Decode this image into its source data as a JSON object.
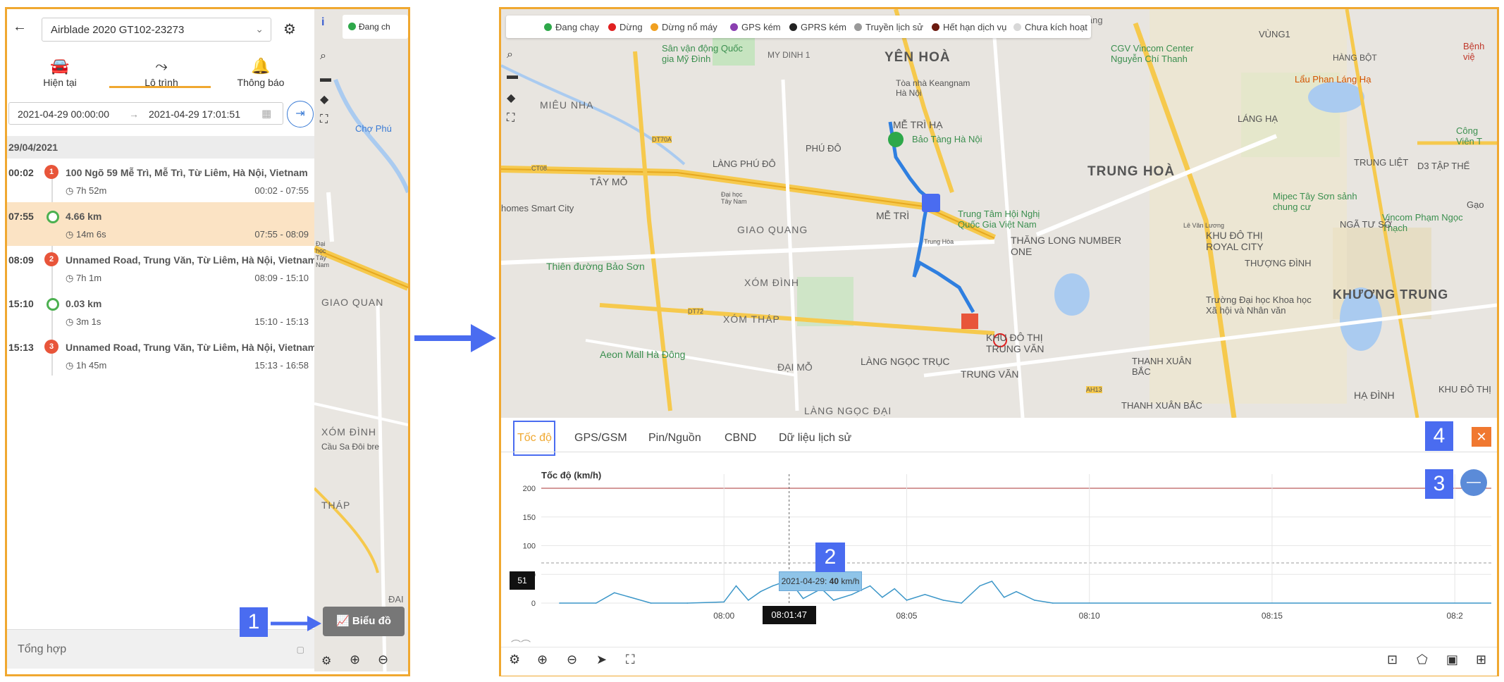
{
  "sidebar": {
    "vehicle_select": "Airblade 2020 GT102-23273",
    "tabs": [
      {
        "label": "Hiện tại",
        "icon": "car-icon"
      },
      {
        "label": "Lộ trình",
        "icon": "route-icon"
      },
      {
        "label": "Thông báo",
        "icon": "bell-icon"
      }
    ],
    "date_from": "2021-04-29 00:00:00",
    "date_to": "2021-04-29 17:01:51",
    "day_header": "29/04/2021",
    "trips": [
      {
        "time": "00:02",
        "marker": "1",
        "type": "stop",
        "address": "100 Ngõ 59 Mễ Trì, Mễ Trì, Từ Liêm, Hà Nội, Vietnam",
        "duration": "7h 52m",
        "range": "00:02 - 07:55"
      },
      {
        "time": "07:55",
        "marker": "",
        "type": "move",
        "address": "4.66 km",
        "duration": "14m 6s",
        "range": "07:55 - 08:09"
      },
      {
        "time": "08:09",
        "marker": "2",
        "type": "stop",
        "address": "Unnamed Road, Trung Văn, Từ Liêm, Hà Nội, Vietnam",
        "duration": "7h 1m",
        "range": "08:09 - 15:10"
      },
      {
        "time": "15:10",
        "marker": "",
        "type": "move",
        "address": "0.03 km",
        "duration": "3m 1s",
        "range": "15:10 - 15:13"
      },
      {
        "time": "15:13",
        "marker": "3",
        "type": "stop",
        "address": "Unnamed Road, Trung Văn, Từ Liêm, Hà Nội, Vietnam",
        "duration": "1h 45m",
        "range": "15:13 - 16:58"
      }
    ],
    "summary": "Tổng hợp"
  },
  "mini_map": {
    "legend_partial": "Đang ch",
    "labels": [
      "Chợ Phú",
      "Đại học Tây Nam",
      "GIAO QUAN",
      "XÓM ĐÌNH",
      "Cầu Sa Đôi bre",
      "THÁP",
      "ĐAI"
    ]
  },
  "chart_button": "Biểu đồ",
  "callouts": [
    "1",
    "2",
    "3",
    "4"
  ],
  "map": {
    "legend": [
      {
        "label": "Đang chạy",
        "color": "#2ea84a"
      },
      {
        "label": "Dừng",
        "color": "#e02020"
      },
      {
        "label": "Dừng nổ máy",
        "color": "#f0a020"
      },
      {
        "label": "GPS kém",
        "color": "#8a3fb0"
      },
      {
        "label": "GPRS kém",
        "color": "#222222"
      },
      {
        "label": "Truyền lịch sử",
        "color": "#999999"
      },
      {
        "label": "Hết hạn dịch vụ",
        "color": "#6b1a10"
      },
      {
        "label": "Chưa kích hoạt",
        "color": "#d8d8d8"
      }
    ],
    "places": [
      "Sân vận động Quốc gia Mỹ Đình",
      "MY DINH 1",
      "YÊN HOÀ",
      "Chùa Láng",
      "CGV Vincom Center Nguyễn Chí Thanh",
      "VÙNG1",
      "Bệnh việ",
      "HÀNG BỘT",
      "Lẩu Phan Láng Hạ",
      "MIÊU NHA",
      "Tòa nhà Keangnam Hà Nội",
      "MỄ TRÌ HẠ",
      "LÁNG HẠ",
      "Công Viên T",
      "Bảo Tàng Hà Nội",
      "PHÚ ĐÔ",
      "LÀNG PHÚ ĐÔ",
      "TRUNG HOÀ",
      "TRUNG LIỆT",
      "D3 TẬP THỂ",
      "TÂY MỖ",
      "homes Smart City",
      "Đại học Tây Nam",
      "MỄ TRÌ",
      "Trung Tâm Hội Nghị Quốc Gia Việt Nam",
      "Mipec Tây Sơn sảnh chung cư",
      "Vincom Phạm Ngọc Thạch",
      "GIAO QUANG",
      "THĂNG LONG NUMBER ONE",
      "KHU ĐÔ THỊ ROYAL CITY",
      "NGÃ TƯ SỞ",
      "Trung Hòa",
      "Thiên đường Bảo Sơn",
      "THƯỢNG ĐÌNH",
      "XÓM ĐÌNH",
      "KHƯƠNG TRUNG",
      "XÓM THÁP",
      "Trường Đại học Khoa học Xã hội và Nhân văn",
      "Aeon Mall Hà Đông",
      "LÀNG NGỌC TRỤC",
      "KHU ĐÔ THỊ TRUNG VĂN",
      "THANH XUÂN BẮC",
      "ĐẠI MỖ",
      "TRUNG VĂN",
      "HẠ ĐÌNH",
      "KHU ĐÔ THỊ",
      "LÀNG NGỌC ĐẠI",
      "THANH XUÂN BẮC",
      "Gạo",
      "Lê Văn Lương",
      "CT08",
      "DT70A",
      "DT72",
      "AH13"
    ]
  },
  "chart_tabs": [
    "Tốc độ",
    "GPS/GSM",
    "Pin/Nguồn",
    "CBND",
    "Dữ liệu lịch sử"
  ],
  "chart_data": {
    "type": "line",
    "title": "Tốc độ (km/h)",
    "ylim": [
      0,
      200
    ],
    "yticks": [
      0,
      50,
      100,
      150,
      200
    ],
    "limit_line": 200,
    "xticks": [
      "08:00",
      "08:05",
      "08:10",
      "08:15",
      "08:2"
    ],
    "x": [
      "07:55:30",
      "07:56:30",
      "07:57:00",
      "07:58:00",
      "07:59:00",
      "08:00:00",
      "08:00:20",
      "08:00:40",
      "08:01:00",
      "08:01:20",
      "08:01:47",
      "08:02:10",
      "08:02:40",
      "08:03:00",
      "08:03:30",
      "08:04:00",
      "08:04:20",
      "08:04:40",
      "08:05:00",
      "08:05:30",
      "08:06:00",
      "08:06:30",
      "08:07:00",
      "08:07:20",
      "08:07:40",
      "08:08:00",
      "08:08:30",
      "08:09:00"
    ],
    "series": [
      {
        "values": [
          0,
          0,
          18,
          0,
          0,
          2,
          30,
          5,
          20,
          30,
          40,
          8,
          25,
          5,
          15,
          30,
          10,
          25,
          5,
          15,
          5,
          0,
          30,
          38,
          10,
          20,
          5,
          0
        ]
      }
    ],
    "tooltip": {
      "date": "2021-04-29",
      "value": "40",
      "unit": "km/h"
    },
    "current_time": "08:01:47",
    "y_badge": "51"
  }
}
